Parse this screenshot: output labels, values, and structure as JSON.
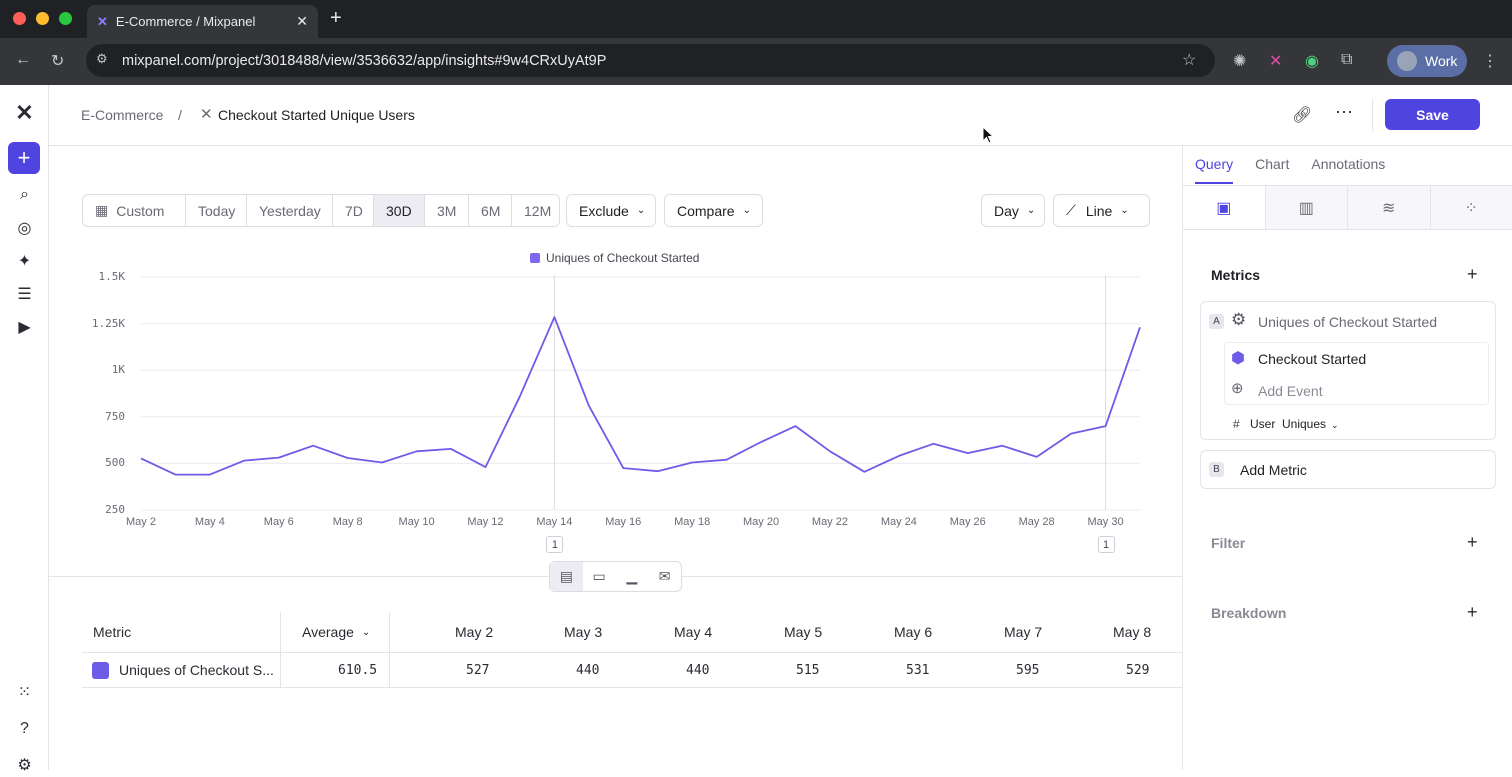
{
  "browser": {
    "tab_title": "E-Commerce / Mixpanel",
    "url": "mixpanel.com/project/3018488/view/3536632/app/insights#9w4CRxUyAt9P",
    "profile_label": "Work"
  },
  "header": {
    "project": "E-Commerce",
    "separator": "/",
    "report_title": "Checkout Started Unique Users",
    "save_label": "Save"
  },
  "toolbar": {
    "date_ranges": [
      "Custom",
      "Today",
      "Yesterday",
      "7D",
      "30D",
      "3M",
      "6M",
      "12M"
    ],
    "active_range": "30D",
    "exclude_label": "Exclude",
    "compare_label": "Compare",
    "interval_label": "Day",
    "chart_type_label": "Line"
  },
  "chart_data": {
    "type": "line",
    "legend": [
      "Uniques of Checkout Started"
    ],
    "color": "#6c5ce7",
    "ylim": [
      250,
      1500
    ],
    "y_ticks": [
      "250",
      "500",
      "750",
      "1K",
      "1.25K",
      "1.5K"
    ],
    "x_tick_labels": [
      "May 2",
      "May 4",
      "May 6",
      "May 8",
      "May 10",
      "May 12",
      "May 14",
      "May 16",
      "May 18",
      "May 20",
      "May 22",
      "May 24",
      "May 26",
      "May 28",
      "May 30"
    ],
    "x": [
      "May 2",
      "May 3",
      "May 4",
      "May 5",
      "May 6",
      "May 7",
      "May 8",
      "May 9",
      "May 10",
      "May 11",
      "May 12",
      "May 13",
      "May 14",
      "May 15",
      "May 16",
      "May 17",
      "May 18",
      "May 19",
      "May 20",
      "May 21",
      "May 22",
      "May 23",
      "May 24",
      "May 25",
      "May 26",
      "May 27",
      "May 28",
      "May 29",
      "May 30",
      "May 31"
    ],
    "series": [
      {
        "name": "Uniques of Checkout Started",
        "values": [
          527,
          440,
          440,
          515,
          531,
          595,
          529,
          505,
          565,
          578,
          480,
          860,
          1285,
          810,
          475,
          458,
          505,
          520,
          615,
          700,
          565,
          455,
          540,
          605,
          555,
          595,
          535,
          660,
          700,
          1230
        ]
      }
    ],
    "annotations": [
      {
        "x": "May 14",
        "count": "1"
      },
      {
        "x": "May 30",
        "count": "1"
      }
    ],
    "grid": true,
    "legend_position": "top-center"
  },
  "table": {
    "headers": [
      "Metric",
      "Average",
      "May 2",
      "May 3",
      "May 4",
      "May 5",
      "May 6",
      "May 7",
      "May 8"
    ],
    "rows": [
      {
        "metric": "Uniques of Checkout S...",
        "average": "610.5",
        "values": [
          "527",
          "440",
          "440",
          "515",
          "531",
          "595",
          "529"
        ]
      }
    ]
  },
  "panel": {
    "tabs": [
      "Query",
      "Chart",
      "Annotations"
    ],
    "active_tab": "Query",
    "metrics_title": "Metrics",
    "metric_a_letter": "A",
    "metric_a_name": "Uniques of Checkout Started",
    "event_name": "Checkout Started",
    "add_event": "Add Event",
    "measure_hash": "#",
    "measure_user": "User",
    "measure_type": "Uniques",
    "metric_b_letter": "B",
    "add_metric": "Add Metric",
    "filter_title": "Filter",
    "breakdown_title": "Breakdown"
  }
}
